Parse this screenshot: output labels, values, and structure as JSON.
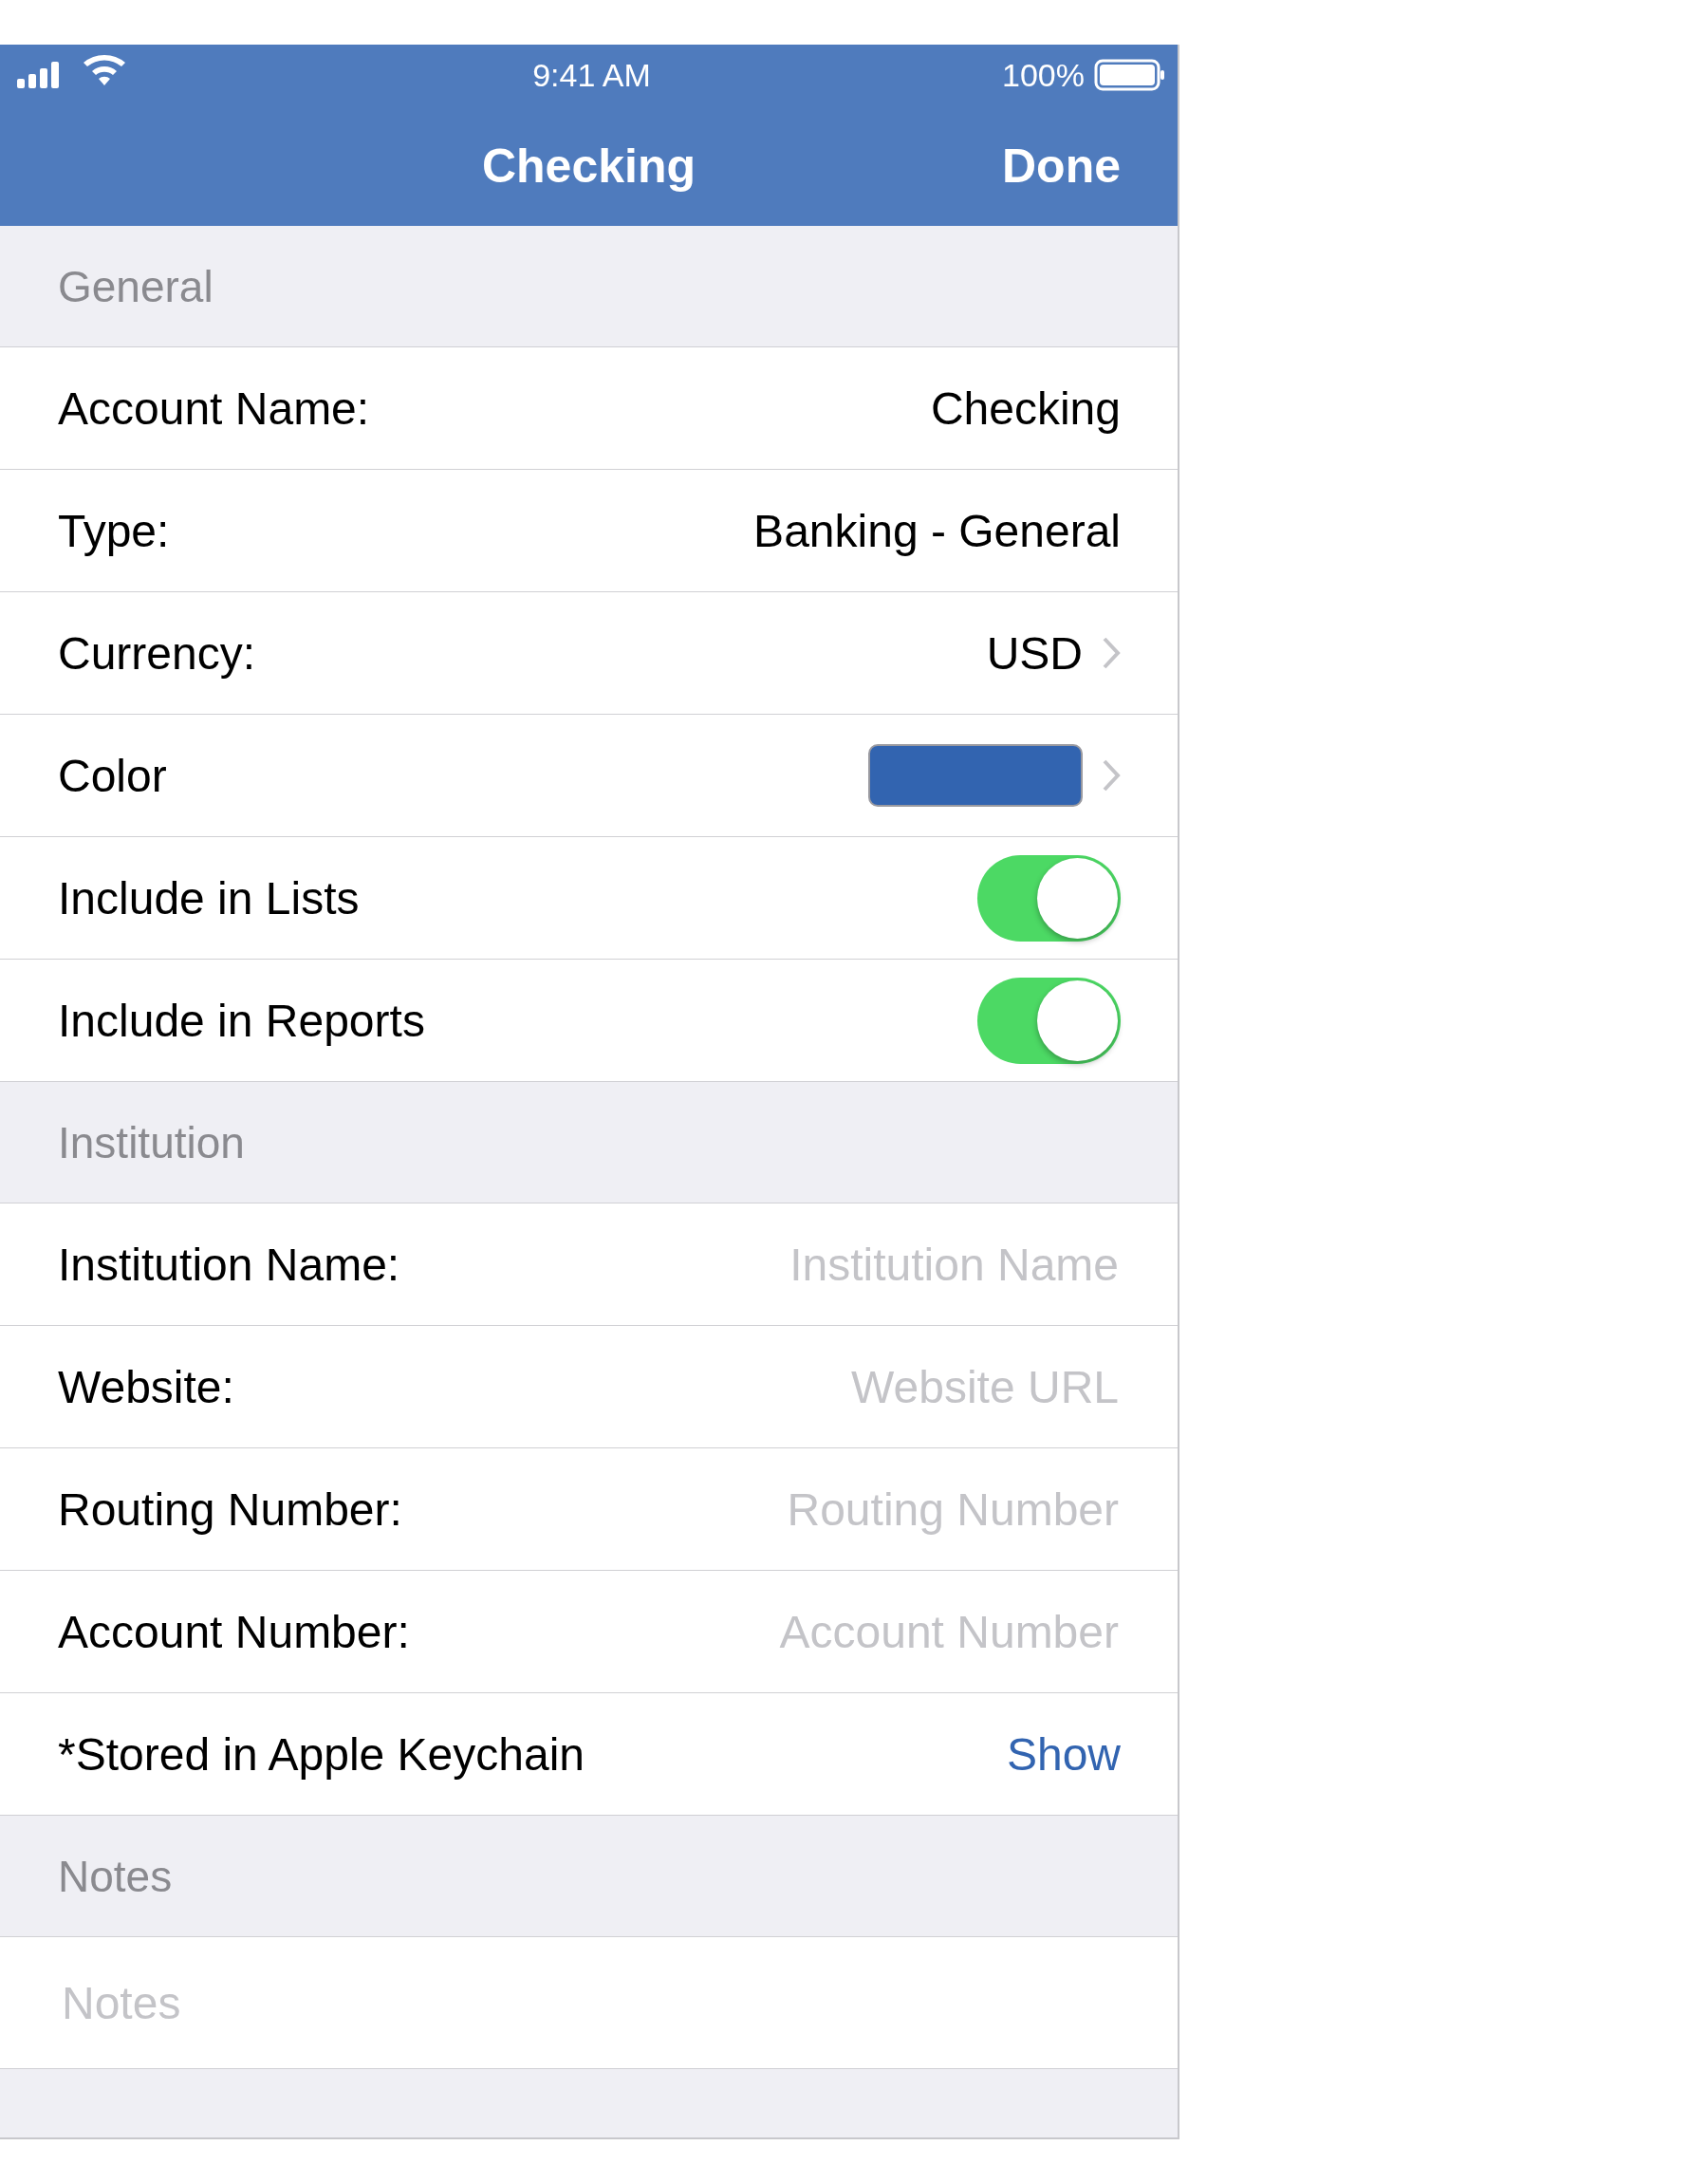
{
  "status_bar": {
    "time": "9:41 AM",
    "battery": "100%"
  },
  "nav_bar": {
    "title": "Checking",
    "done": "Done"
  },
  "sections": [
    {
      "header": "General",
      "rows": [
        {
          "kind": "value",
          "label": "Account Name:",
          "value": "Checking"
        },
        {
          "kind": "value",
          "label": "Type:",
          "value": "Banking - General"
        },
        {
          "kind": "link",
          "label": "Currency:",
          "value": "USD"
        },
        {
          "kind": "color",
          "label": "Color",
          "color": "#3264b0"
        },
        {
          "kind": "toggle",
          "label": "Include in Lists",
          "on": true
        },
        {
          "kind": "toggle",
          "label": "Include in Reports",
          "on": true
        }
      ]
    },
    {
      "header": "Institution",
      "rows": [
        {
          "kind": "field",
          "label": "Institution Name:",
          "placeholder": "Institution Name"
        },
        {
          "kind": "field",
          "label": "Website:",
          "placeholder": "Website URL"
        },
        {
          "kind": "field",
          "label": "Routing Number:",
          "placeholder": "Routing Number"
        },
        {
          "kind": "field",
          "label": "Account Number:",
          "placeholder": "Account Number"
        },
        {
          "kind": "action",
          "label": "*Stored in Apple Keychain",
          "action": "Show"
        }
      ]
    },
    {
      "header": "Notes",
      "rows": [
        {
          "kind": "notes",
          "placeholder": "Notes"
        }
      ]
    }
  ]
}
